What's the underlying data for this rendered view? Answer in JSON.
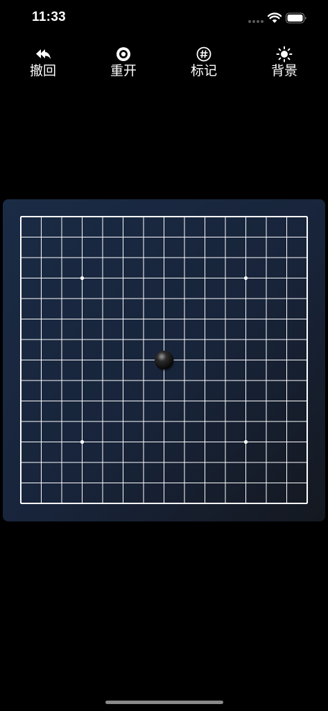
{
  "status_bar": {
    "time": "11:33",
    "icons": [
      "signal-dots-icon",
      "wifi-icon",
      "battery-icon"
    ]
  },
  "toolbar": {
    "buttons": [
      {
        "id": "undo",
        "label": "撤回",
        "icon": "undo-double-arrow-icon"
      },
      {
        "id": "restart",
        "label": "重开",
        "icon": "restart-ring-icon"
      },
      {
        "id": "mark",
        "label": "标记",
        "icon": "hash-circle-icon"
      },
      {
        "id": "background",
        "label": "背景",
        "icon": "sun-icon"
      }
    ]
  },
  "board": {
    "lines": 15,
    "star_points": [
      [
        3,
        3
      ],
      [
        11,
        3
      ],
      [
        3,
        11
      ],
      [
        11,
        11
      ]
    ],
    "stones": [
      {
        "color": "black",
        "col": 7,
        "row": 7
      }
    ],
    "colors": {
      "grid": "#ffffff",
      "board_top": "#1a2b45",
      "board_bottom": "#141820"
    }
  }
}
